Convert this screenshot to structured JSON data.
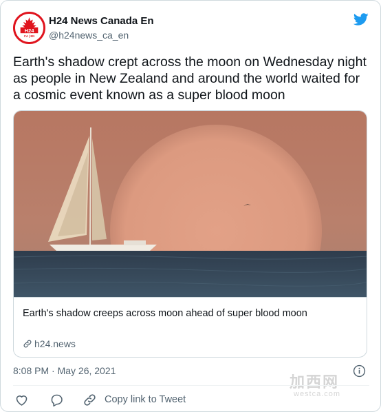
{
  "author": {
    "name": "H24 News Canada En",
    "handle": "@h24news_ca_en",
    "avatar_text": "H24",
    "avatar_subtext": "CA | EN"
  },
  "tweet": {
    "text": "Earth's shadow crept across the moon on Wednesday night as people in New Zealand and around the world waited for a cosmic event known as a super blood moon",
    "timestamp": "8:08 PM · May 26, 2021"
  },
  "card": {
    "title": "Earth's shadow creeps across moon ahead of super blood moon",
    "domain": "h24.news"
  },
  "actions": {
    "copy_link_label": "Copy link to Tweet"
  },
  "watermark": {
    "cn": "加西网",
    "en": "westca.com"
  },
  "colors": {
    "brand_blue": "#1d9bf0",
    "avatar_red": "#e0141e",
    "secondary_text": "#536471"
  }
}
